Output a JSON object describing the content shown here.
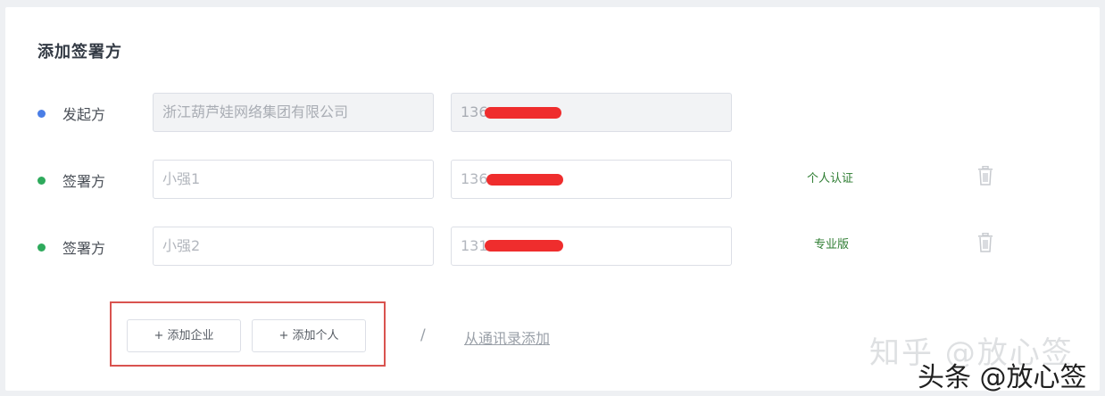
{
  "section": {
    "title": "添加签署方"
  },
  "rows": [
    {
      "role": "发起方",
      "dot_color": "#4a7ee6",
      "name_value": "浙江葫芦娃网络集团有限公司",
      "phone_prefix": "136",
      "disabled": true
    },
    {
      "role": "签署方",
      "dot_color": "#2eaa5c",
      "name_value": "小强1",
      "phone_prefix": "136",
      "tag": "个人认证",
      "disabled": false
    },
    {
      "role": "签署方",
      "dot_color": "#2eaa5c",
      "name_value": "小强2",
      "phone_prefix": "131",
      "tag": "专业版",
      "disabled": false
    }
  ],
  "actions": {
    "add_company_label": "+ 添加企业",
    "add_person_label": "+ 添加个人",
    "divider": "/",
    "from_contacts_label": "从通讯录添加"
  },
  "watermarks": {
    "zhihu": "知乎 @放心签",
    "toutiao": "头条 @放心签"
  },
  "colors": {
    "highlight_border": "#d9534f",
    "redaction": "#ef2d2d",
    "tag_text": "#2e7d32"
  }
}
